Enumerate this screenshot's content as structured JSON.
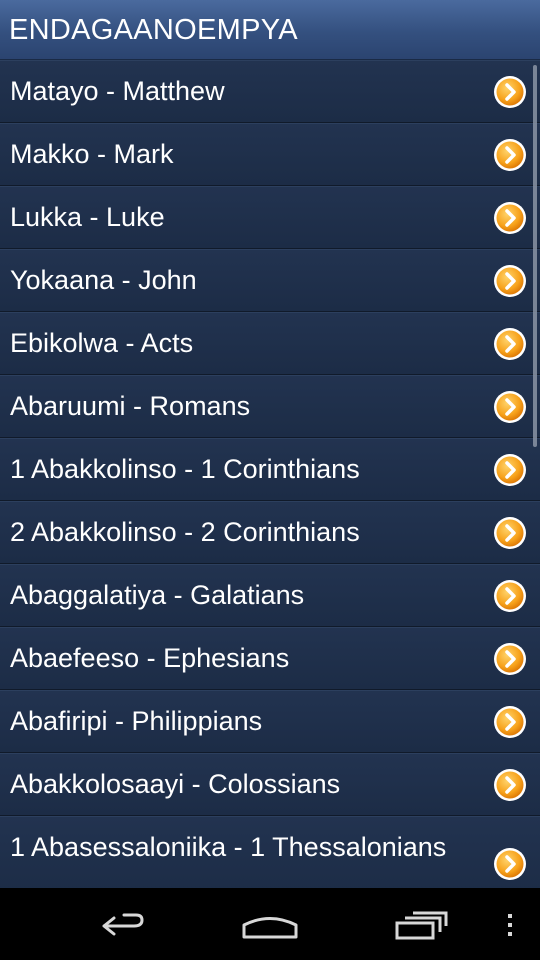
{
  "app": {
    "title": "ENDAGAANOEMPYA"
  },
  "books": [
    {
      "label": "Matayo - Matthew"
    },
    {
      "label": "Makko - Mark"
    },
    {
      "label": "Lukka - Luke"
    },
    {
      "label": "Yokaana - John"
    },
    {
      "label": "Ebikolwa - Acts"
    },
    {
      "label": "Abaruumi - Romans"
    },
    {
      "label": "1 Abakkolinso - 1 Corinthians"
    },
    {
      "label": "2 Abakkolinso - 2 Corinthians"
    },
    {
      "label": "Abaggalatiya - Galatians"
    },
    {
      "label": "Abaefeeso - Ephesians"
    },
    {
      "label": "Abafiripi - Philippians"
    },
    {
      "label": "Abakkolosaayi - Colossians"
    },
    {
      "label": "1 Abasessaloniika - 1 Thessalonians"
    }
  ],
  "icons": {
    "row_arrow": "chevron-right-circle-icon",
    "nav_back": "back-icon",
    "nav_home": "home-icon",
    "nav_recents": "recent-apps-icon",
    "nav_menu": "overflow-menu-icon"
  },
  "colors": {
    "titlebar": "#34507f",
    "row_background": "#1e2e49",
    "arrow_fill": "#f7a21b",
    "text": "#ffffff"
  }
}
